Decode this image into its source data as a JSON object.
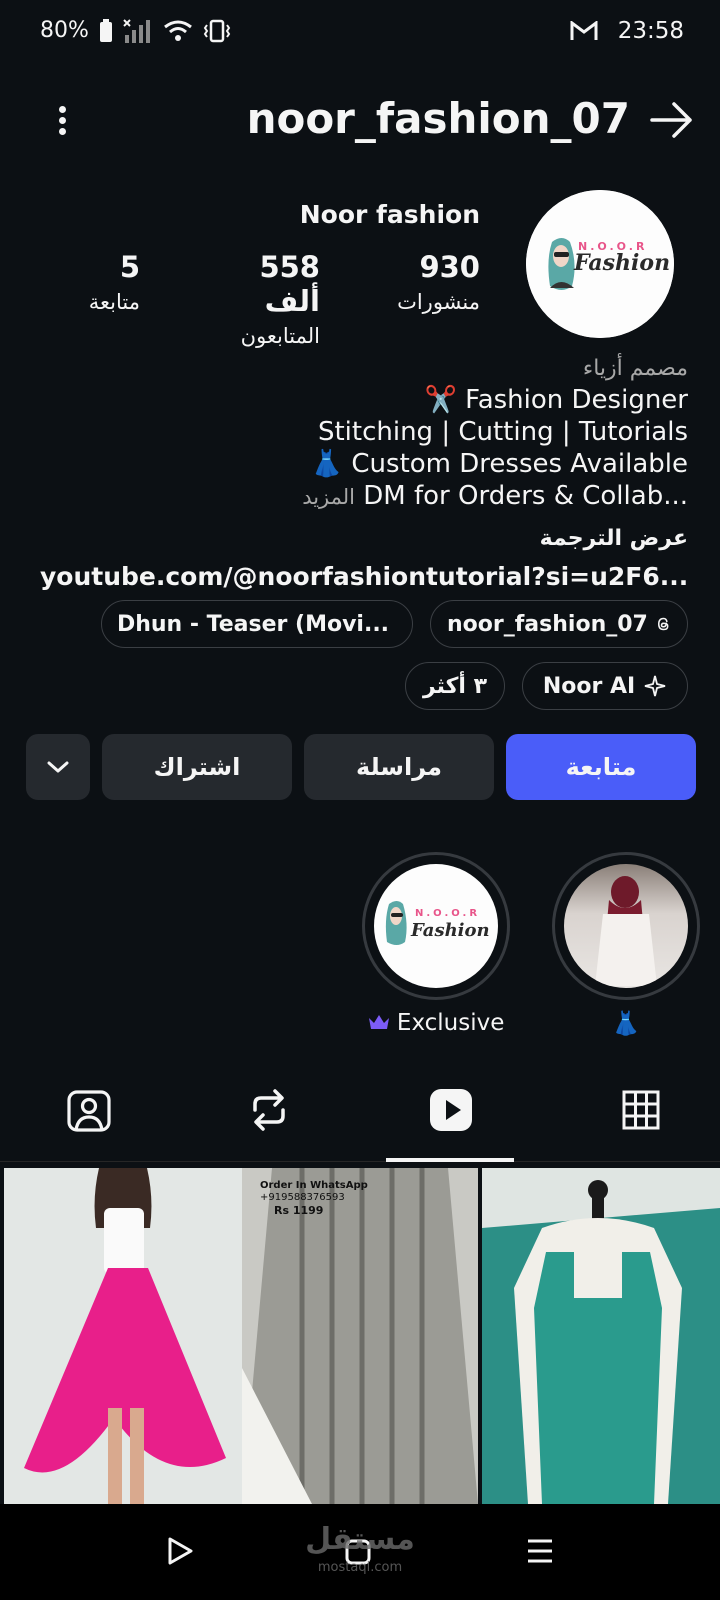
{
  "status_bar": {
    "battery": "80%",
    "time": "23:58"
  },
  "header": {
    "username": "noor_fashion_07"
  },
  "profile": {
    "display_name": "Noor fashion",
    "avatar_text_top": "N.O.O.R",
    "avatar_text_bottom": "Fashion",
    "stats": {
      "posts": {
        "value": "930",
        "label": "منشورات"
      },
      "followers": {
        "value": "558 ألف",
        "label": "المتابعون"
      },
      "following": {
        "value": "5",
        "label": "متابعة"
      }
    },
    "category": "مصمم أزياء",
    "bio_lines": [
      "✂️ Fashion Designer",
      "Stitching | Cutting | Tutorials",
      "👗 Custom Dresses Available",
      "DM for Orders & Collab..."
    ],
    "more_label": "المزيد",
    "translate_label": "عرض الترجمة",
    "link": "youtube.com/@noorfashiontutorial?si=u2F6..."
  },
  "chips": {
    "threads": "noor_fashion_07",
    "music": "Dhun - Teaser (Movi...",
    "ai": "Noor AI",
    "more": "٣ أكثر"
  },
  "actions": {
    "follow": "متابعة",
    "message": "مراسلة",
    "subscribe": "اشتراك"
  },
  "highlights": [
    {
      "label": "👗"
    },
    {
      "label": "Exclusive"
    }
  ],
  "grid": {
    "item2_text1": "Order In WhatsApp",
    "item2_text2": "+919588376593",
    "item2_text3": "Rs 1199"
  },
  "watermark": {
    "top": "مستقل",
    "bottom": "mostaql.com"
  },
  "colors": {
    "background": "#0c1014",
    "primary_button": "#4a5df9",
    "secondary_button": "#25292e"
  }
}
